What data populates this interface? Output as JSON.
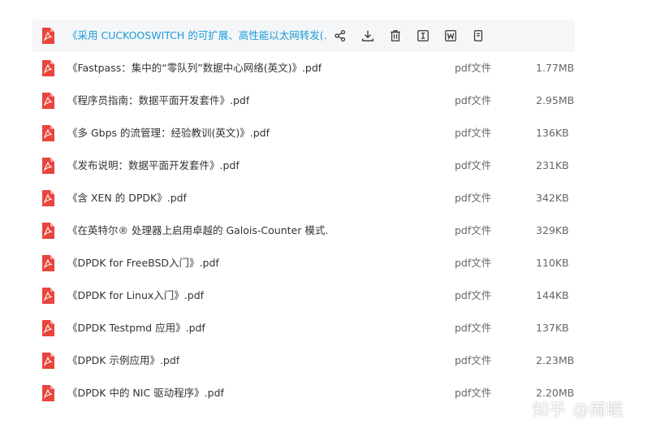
{
  "files": [
    {
      "name": "《采用 CUCKOOSWITCH 的可扩展、高性能以太网转发(...",
      "type": "",
      "size": ""
    },
    {
      "name": "《Fastpass：集中的“零队列”数据中心网络(英文)》.pdf",
      "type": "pdf文件",
      "size": "1.77MB"
    },
    {
      "name": "《程序员指南：数据平面开发套件》.pdf",
      "type": "pdf文件",
      "size": "2.95MB"
    },
    {
      "name": "《多 Gbps 的流管理：经验教训(英文)》.pdf",
      "type": "pdf文件",
      "size": "136KB"
    },
    {
      "name": "《发布说明：数据平面开发套件》.pdf",
      "type": "pdf文件",
      "size": "231KB"
    },
    {
      "name": "《含 XEN 的 DPDK》.pdf",
      "type": "pdf文件",
      "size": "342KB"
    },
    {
      "name": "《在英特尔® 处理器上启用卓越的 Galois-Counter 模式...",
      "type": "pdf文件",
      "size": "329KB"
    },
    {
      "name": "《DPDK for FreeBSD入门》.pdf",
      "type": "pdf文件",
      "size": "110KB"
    },
    {
      "name": "《DPDK for Linux入门》.pdf",
      "type": "pdf文件",
      "size": "144KB"
    },
    {
      "name": "《DPDK Testpmd 应用》.pdf",
      "type": "pdf文件",
      "size": "137KB"
    },
    {
      "name": "《DPDK 示例应用》.pdf",
      "type": "pdf文件",
      "size": "2.23MB"
    },
    {
      "name": "《DPDK 中的 NIC 驱动程序》.pdf",
      "type": "pdf文件",
      "size": "2.20MB"
    }
  ],
  "hover_actions": [
    "share-icon",
    "download-icon",
    "delete-icon",
    "text-extract-icon",
    "word-convert-icon",
    "more-icon"
  ],
  "watermark": "知乎 @雨眠",
  "colors": {
    "pdf_red": "#e8453c",
    "link_blue": "#1a9bd7",
    "hover_bg": "#f5f6f8"
  }
}
